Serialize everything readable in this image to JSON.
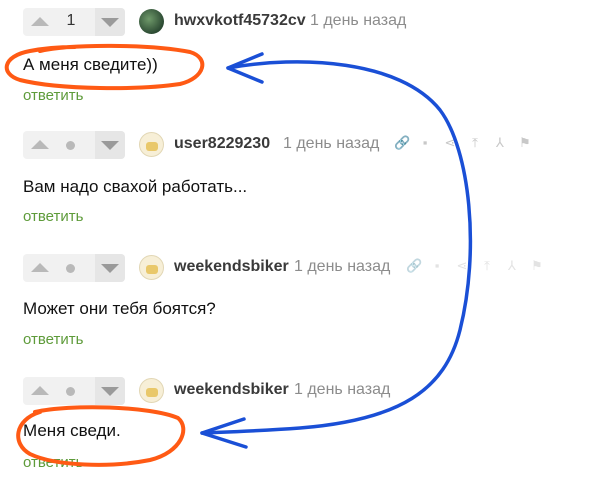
{
  "comments": [
    {
      "score": "1",
      "author": "hwxvkotf45732cv",
      "time": "1 день назад",
      "text": "А меня сведите))",
      "reply": "ответить",
      "avatar": "dark"
    },
    {
      "score": "",
      "author": "user8229230",
      "time": "1 день назад",
      "text": "Вам надо свахой работать...",
      "reply": "ответить",
      "avatar": "light"
    },
    {
      "score": "",
      "author": "weekendsbiker",
      "time": "1 день назад",
      "text": "Может они тебя боятся?",
      "reply": "ответить",
      "avatar": "light"
    },
    {
      "score": "",
      "author": "weekendsbiker",
      "time": "1 день назад",
      "text": "Меня сведи.",
      "reply": "ответить",
      "avatar": "light"
    }
  ],
  "actions": [
    "link-icon",
    "save-icon",
    "share-icon",
    "to-top-icon",
    "branch-icon",
    "flag-icon"
  ],
  "annotation_colors": {
    "circle": "#ff5a14",
    "arrow": "#1a4fd6"
  }
}
